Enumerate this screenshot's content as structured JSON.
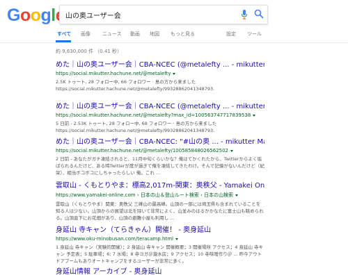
{
  "logo": {
    "letters": [
      "G",
      "o",
      "o",
      "g",
      "l",
      "e"
    ],
    "colors": [
      "#4285F4",
      "#EA4335",
      "#FBBC05",
      "#4285F4",
      "#34A853",
      "#EA4335"
    ]
  },
  "search": {
    "query": "山の奥ユーザー会"
  },
  "tabs": {
    "all": "すべて",
    "images": "画像",
    "news": "ニュース",
    "videos": "動画",
    "maps": "地図",
    "more": "もっと見る",
    "settings": "設定",
    "tools": "ツール"
  },
  "stats": "約 9,630,000 件 （0.41 秒）",
  "results": [
    {
      "title": "めた｜山の奥ユーザー会｜CBA-NCEC (@metalefty ... - mikutter Mastodon",
      "url": "https://social.mikutter.hachune.net/@metalefty",
      "snippet": "2.5K トゥート, 28 フォロー中, 66 フォロワー · 島の方から来ました https://social.mikutter.hachune.net/@metalefty/99328862041348793."
    },
    {
      "title": "めた｜山の奥ユーザー会｜CBA-NCEC (@metalefty ... - mikutter Mastodon",
      "url": "https://social.mikutter.hachune.net/@metalefty?max_id=100563747717839538",
      "snippet": "5 日前 - 2.53K トゥート, 28 フォロー中, 68 フォロワー · 島の方から来ました https://social.mikutter.hachune.net/@metalefty/99328862041348793."
    },
    {
      "title": "めた｜山の奥ユーザー会｜CBA-NCEC: \"#山の奥 ... - mikutter Mastodon",
      "url": "https://social.mikutter.hachune.net/@metalefty/100585848026562502",
      "snippet": "2 日前 - あなたがガチ凍結されると、11月中旬くらいかな？俺はてかくれたから、Twitterからよく垢ぱられるんだけど、ある時Twitterが度が過ぎて俺を凍結してきたわけ。そんで記憶がないんだけど（紀栄）、相当ボコボコにしちゃったらしい 俺。これ ..."
    },
    {
      "title": "雲取山 - くもとりやま：標高2,017m-関東：奥秩父 - Yamakei Online / 山 ...",
      "url": "https://www.yamakei-online.com › 日本の山＆登山ルート検索 › 日本の山検索",
      "snippet": "雲取山（くもとりやま）関東：奥秩父 三峰山の最高峰。山頂の一部には埼玉県も含まれていることを知る人は少ない。山頂からの展望は北を除いて非常によく、山並みのはるかかなたに富士山も眺められる。山頂直下にお花畑があり、山頂の避難小屋も利用し ..."
    },
    {
      "title": "身延山 寺キャン（てらきゃん）開催！ - 奥身延山",
      "url": "https://www.oku-minobusan.com/teracamp.html",
      "snippet": "1 身延山 寺キャン（実験的開催）；2 身延山 寺キャン 開催概要；3 開催場所 アクセス；4 身延山 寺キャン 予定表；5 駐車場；6; 7 水場；8 寺ヨガ＠瀧水房；9 アクセス；10 寺味噌作り＠ ... 昨今アウトドアブームもありオートキャンプをするユーザーが非常に多く。"
    },
    {
      "title": "身延山情報 アーカイブ - 奥身延山",
      "url": "",
      "snippet": ""
    }
  ]
}
